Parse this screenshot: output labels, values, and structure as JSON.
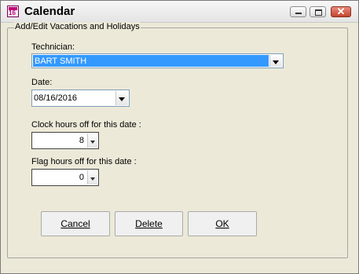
{
  "window": {
    "title": "Calendar",
    "icon": "calendar-app-icon",
    "icon_text": "16",
    "controls": [
      "minimize-icon",
      "maximize-icon",
      "close-icon"
    ]
  },
  "group": {
    "title": "Add/Edit Vacations and Holidays"
  },
  "technician": {
    "label": "Technician:",
    "value": "BART SMITH"
  },
  "date": {
    "label": "Date:",
    "value": "08/16/2016"
  },
  "clock_hours": {
    "label": "Clock hours off for this date :",
    "value": "8"
  },
  "flag_hours": {
    "label": "Flag hours off for this date :",
    "value": "0"
  },
  "buttons": {
    "cancel": "Cancel",
    "delete": "Delete",
    "ok": "OK"
  },
  "colors": {
    "selection": "#3399ff",
    "window_bg": "#ece9d8",
    "close_button": "#c4452e"
  }
}
